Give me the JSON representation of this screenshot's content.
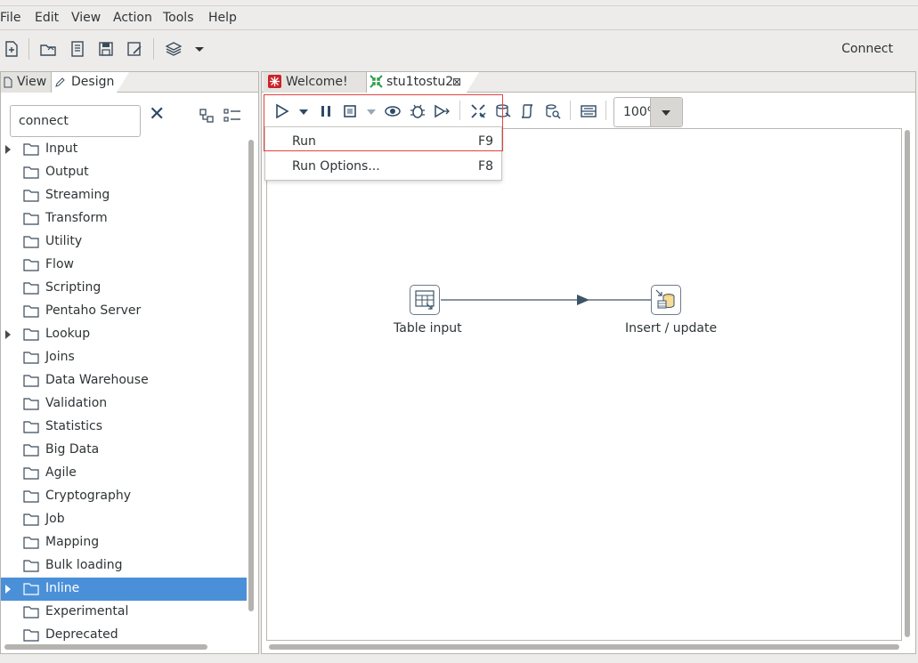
{
  "menubar": {
    "items": [
      "File",
      "Edit",
      "View",
      "Action",
      "Tools",
      "Help"
    ]
  },
  "toolbar": {
    "icons": [
      "new-file-icon",
      "open-folder-icon",
      "explore-repository-icon",
      "save-icon",
      "save-as-icon",
      "layers-icon",
      "dropdown-arrow-icon"
    ],
    "connect_label": "Connect"
  },
  "left_panel": {
    "tabs": [
      {
        "label": "View",
        "icon": "document-icon"
      },
      {
        "label": "Design",
        "icon": "pencil-icon"
      }
    ],
    "search": {
      "value": "connect"
    },
    "tree": [
      {
        "label": "Input",
        "expandable": true,
        "selected": false
      },
      {
        "label": "Output",
        "expandable": false,
        "selected": false
      },
      {
        "label": "Streaming",
        "expandable": false,
        "selected": false
      },
      {
        "label": "Transform",
        "expandable": false,
        "selected": false
      },
      {
        "label": "Utility",
        "expandable": false,
        "selected": false
      },
      {
        "label": "Flow",
        "expandable": false,
        "selected": false
      },
      {
        "label": "Scripting",
        "expandable": false,
        "selected": false
      },
      {
        "label": "Pentaho Server",
        "expandable": false,
        "selected": false
      },
      {
        "label": "Lookup",
        "expandable": true,
        "selected": false
      },
      {
        "label": "Joins",
        "expandable": false,
        "selected": false
      },
      {
        "label": "Data Warehouse",
        "expandable": false,
        "selected": false
      },
      {
        "label": "Validation",
        "expandable": false,
        "selected": false
      },
      {
        "label": "Statistics",
        "expandable": false,
        "selected": false
      },
      {
        "label": "Big Data",
        "expandable": false,
        "selected": false
      },
      {
        "label": "Agile",
        "expandable": false,
        "selected": false
      },
      {
        "label": "Cryptography",
        "expandable": false,
        "selected": false
      },
      {
        "label": "Job",
        "expandable": false,
        "selected": false
      },
      {
        "label": "Mapping",
        "expandable": false,
        "selected": false
      },
      {
        "label": "Bulk loading",
        "expandable": false,
        "selected": false
      },
      {
        "label": "Inline",
        "expandable": true,
        "selected": true
      },
      {
        "label": "Experimental",
        "expandable": false,
        "selected": false
      },
      {
        "label": "Deprecated",
        "expandable": false,
        "selected": false
      }
    ]
  },
  "editor": {
    "tabs": [
      {
        "label": "Welcome!",
        "icon": "spoon-logo-icon"
      },
      {
        "label": "stu1tostu2",
        "icon": "transformation-icon",
        "closable": true
      }
    ],
    "zoom": "100%",
    "steps": [
      {
        "label": "Table input",
        "icon": "table-input-icon"
      },
      {
        "label": "Insert / update",
        "icon": "insert-update-icon"
      }
    ]
  },
  "run_menu": {
    "items": [
      {
        "label": "Run",
        "shortcut": "F9"
      },
      {
        "label": "Run Options...",
        "shortcut": "F8"
      }
    ]
  },
  "colors": {
    "selection": "#4a90d9",
    "highlight": "#e0443e",
    "hop": "#3d5568"
  }
}
